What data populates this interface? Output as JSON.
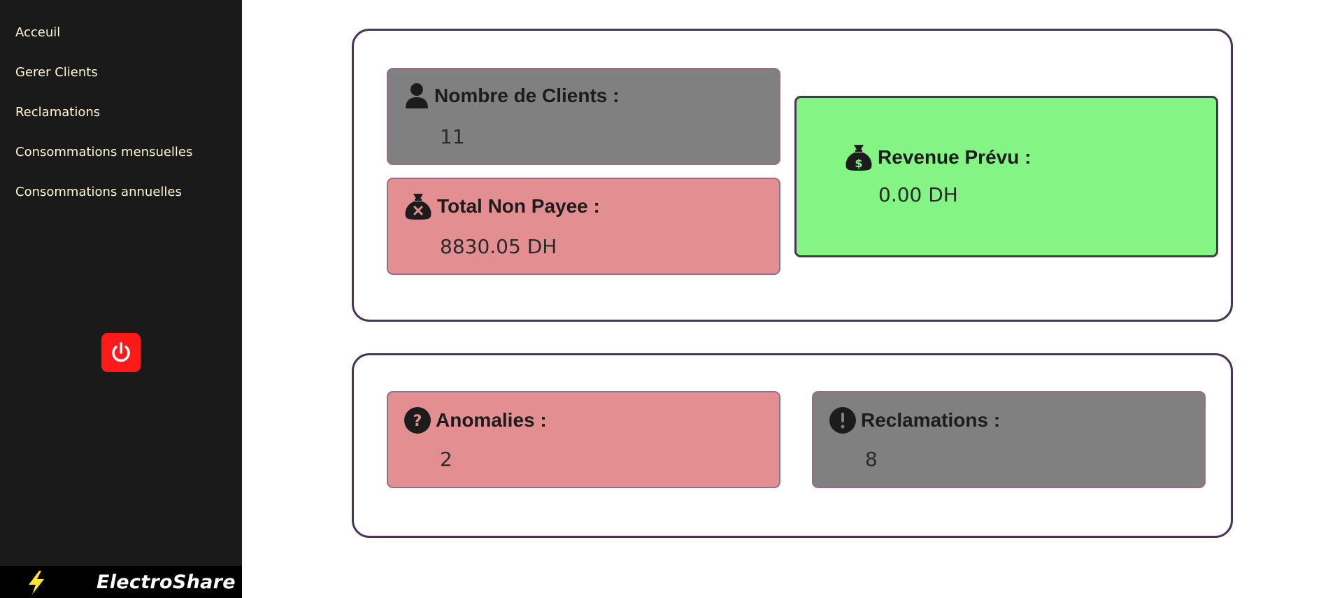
{
  "sidebar": {
    "items": [
      {
        "label": "Acceuil"
      },
      {
        "label": "Gerer Clients"
      },
      {
        "label": "Reclamations"
      },
      {
        "label": "Consommations mensuelles"
      },
      {
        "label": "Consommations annuelles"
      }
    ],
    "logout_icon": "power-icon",
    "brand": {
      "name": "ElectroShare",
      "icon": "lightning-bolt-icon"
    }
  },
  "summary": {
    "clients": {
      "label": "Nombre de Clients :",
      "value": "11",
      "icon": "user-icon"
    },
    "unpaid": {
      "label": "Total Non Payee :",
      "value": "8830.05 DH",
      "icon": "money-bag-x-icon"
    },
    "revenue": {
      "label": "Revenue Prévu :",
      "value": "0.00 DH",
      "icon": "money-bag-dollar-icon"
    }
  },
  "issues": {
    "anomalies": {
      "label": "Anomalies :",
      "value": "2",
      "icon": "question-circle-icon"
    },
    "reclamations": {
      "label": "Reclamations :",
      "value": "8",
      "icon": "exclamation-circle-icon"
    }
  },
  "colors": {
    "sidebar_bg": "#1a1a1a",
    "nav_text": "#fff8d6",
    "logout_bg": "#ff1a1a",
    "card_gray": "#808080",
    "card_red": "#e38f91",
    "card_green": "#84f584",
    "panel_border": "#4a3358"
  }
}
